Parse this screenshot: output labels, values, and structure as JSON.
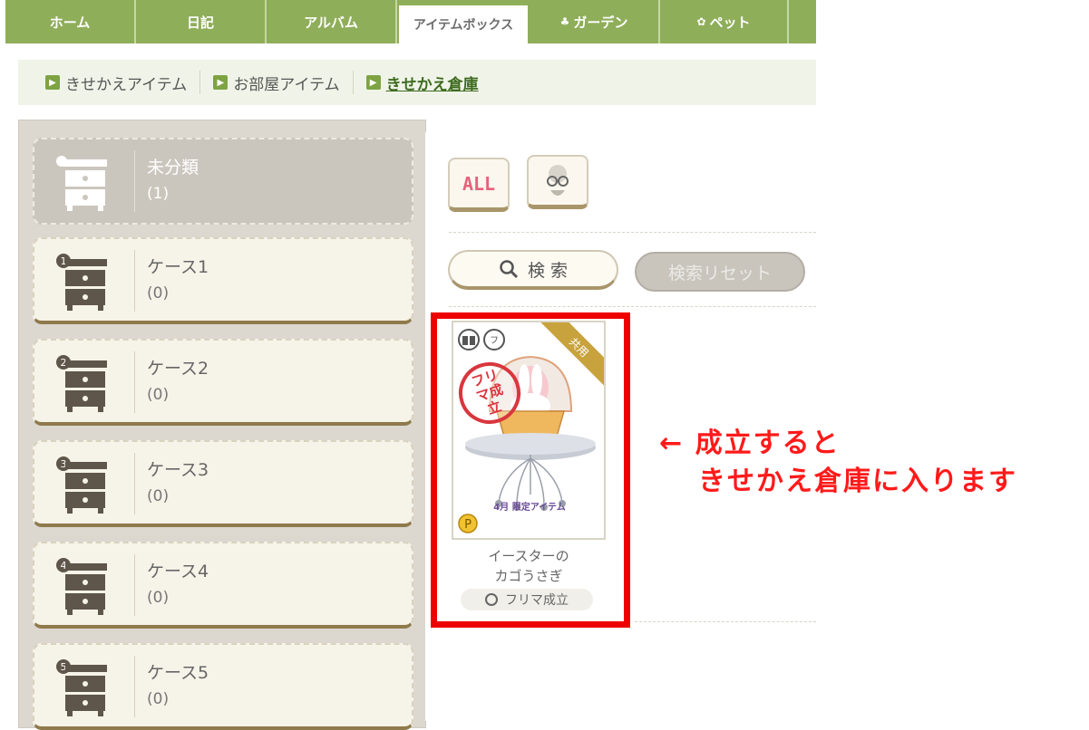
{
  "nav": {
    "tabs": [
      {
        "label": "ホーム",
        "icon": ""
      },
      {
        "label": "日記",
        "icon": ""
      },
      {
        "label": "アルバム",
        "icon": ""
      },
      {
        "label": "アイテムボックス",
        "icon": ""
      },
      {
        "label": "ガーデン",
        "icon": "tulip-icon"
      },
      {
        "label": "ペット",
        "icon": "paw-icon"
      }
    ]
  },
  "subnav": {
    "items": [
      "きせかえアイテム",
      "お部屋アイテム",
      "きせかえ倉庫"
    ]
  },
  "cases": [
    {
      "name": "未分類",
      "count": "(1)"
    },
    {
      "name": "ケース1",
      "count": "(0)"
    },
    {
      "name": "ケース2",
      "count": "(0)"
    },
    {
      "name": "ケース3",
      "count": "(0)"
    },
    {
      "name": "ケース4",
      "count": "(0)"
    },
    {
      "name": "ケース5",
      "count": "(0)"
    }
  ],
  "filters": {
    "all_label": "ALL"
  },
  "search": {
    "search_label": "検 索",
    "reset_label": "検索リセット"
  },
  "item": {
    "ribbon": "共用",
    "stamp": "フリマ成立",
    "badge": "4月 限定アイテム",
    "name_line1": "イースターの",
    "name_line2": "カゴうさぎ",
    "status": "フリマ成立"
  },
  "annotation": {
    "line1": "←  成立すると",
    "line2": "きせかえ倉庫に入ります"
  },
  "colors": {
    "nav_green": "#8fae5a",
    "highlight_red": "#ee0000",
    "annotation_red": "#ff1a1a"
  }
}
